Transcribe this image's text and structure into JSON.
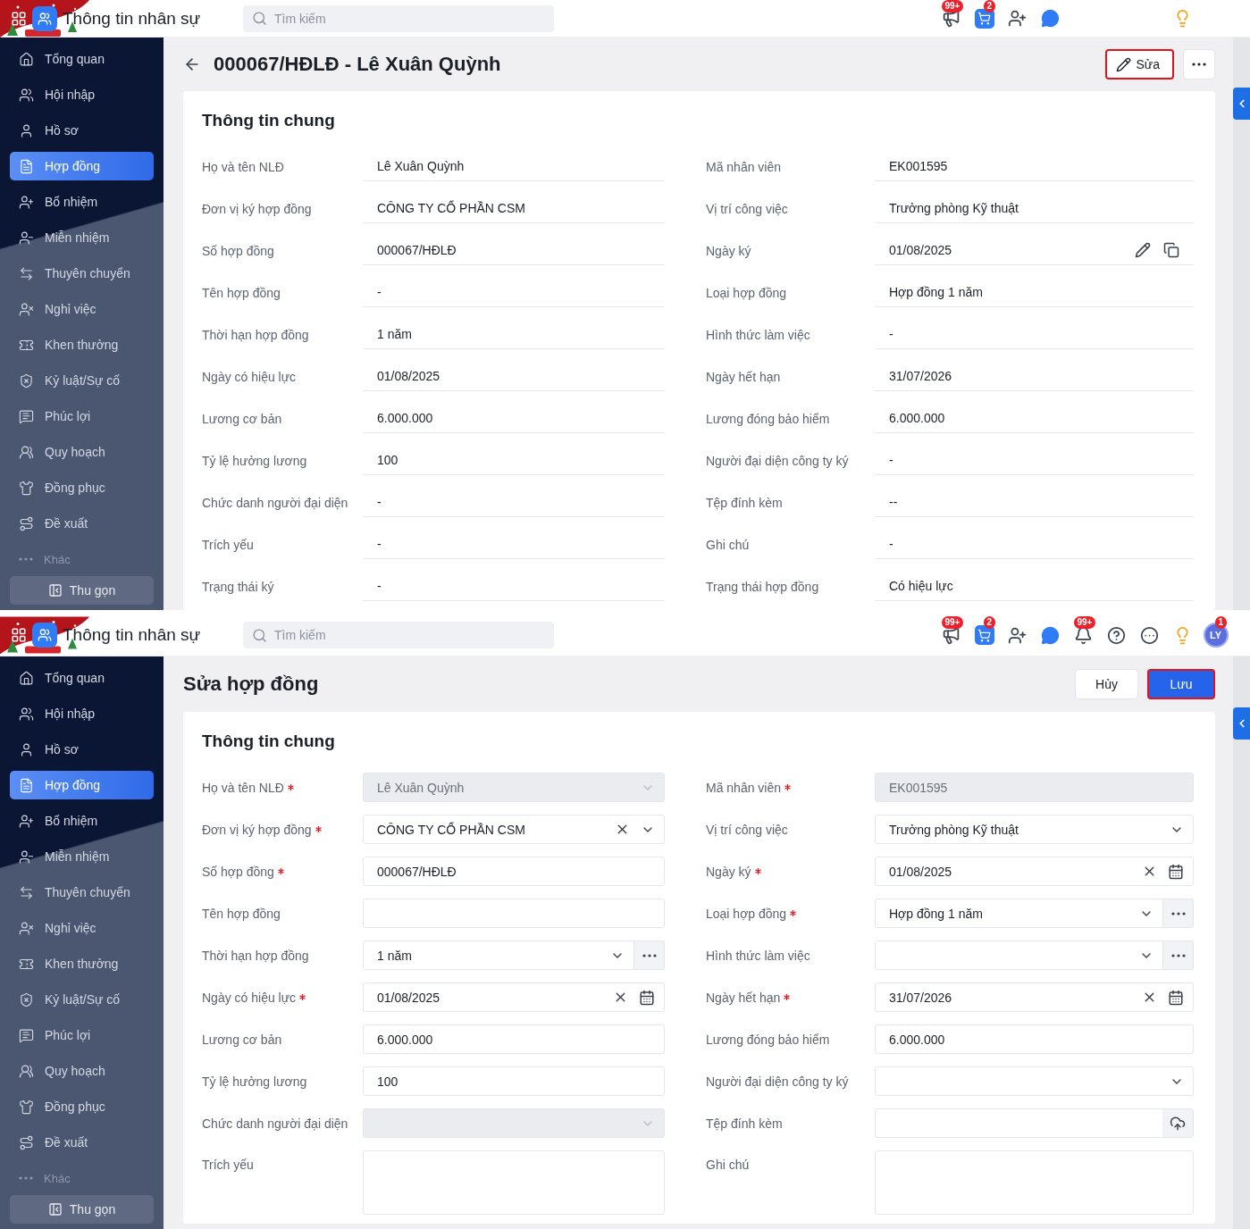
{
  "screens": [
    {
      "kind": "view",
      "header": {
        "app_title": "Thông tin nhân sự",
        "search": {
          "placeholder": "Tìm kiếm"
        },
        "icons": [
          {
            "kind": "megaphone",
            "badge": "99+"
          },
          {
            "kind": "cart",
            "badge": "2"
          },
          {
            "kind": "user-add"
          },
          {
            "kind": "chat"
          },
          {
            "kind": "lightbulb"
          }
        ]
      },
      "sidebar": {
        "items": [
          {
            "label": "Tổng quan",
            "selected": false
          },
          {
            "label": "Hội nhập",
            "selected": false
          },
          {
            "label": "Hồ sơ",
            "selected": false
          },
          {
            "label": "Hợp đồng",
            "selected": true
          },
          {
            "label": "Bổ nhiệm",
            "selected": false
          },
          {
            "label": "Miễn nhiệm",
            "selected": false
          },
          {
            "label": "Thuyên chuyển",
            "selected": false
          },
          {
            "label": "Nghỉ việc",
            "selected": false
          },
          {
            "label": "Khen thưởng",
            "selected": false
          },
          {
            "label": "Kỷ luật/Sự cố",
            "selected": false
          },
          {
            "label": "Phúc lợi",
            "selected": false
          },
          {
            "label": "Quy hoạch",
            "selected": false
          },
          {
            "label": "Đồng phục",
            "selected": false
          },
          {
            "label": "Đề xuất",
            "selected": false
          }
        ],
        "more_label": "Khác",
        "collapse_label": "Thu gọn"
      },
      "page": {
        "title": "000067/HĐLĐ - Lê Xuân Quỳnh",
        "buttons": [
          {
            "kind": "edit",
            "label": "Sửa",
            "highlighted": true
          },
          {
            "kind": "more",
            "highlighted": false
          }
        ],
        "section_title": "Thông tin chung",
        "fields": [
          {
            "label": "Họ và tên NLĐ",
            "value": "Lê Xuân Quỳnh"
          },
          {
            "label": "Mã nhân viên",
            "value": "EK001595"
          },
          {
            "label": "Đơn vị ký hợp đồng",
            "value": "CÔNG TY CỔ PHẦN CSM"
          },
          {
            "label": "Vị trí công việc",
            "value": "Trưởng phòng Kỹ thuật"
          },
          {
            "label": "Số hợp đồng",
            "value": "000067/HĐLĐ"
          },
          {
            "label": "Ngày ký",
            "value": "01/08/2025",
            "actions": true
          },
          {
            "label": "Tên hợp đồng",
            "value": "-"
          },
          {
            "label": "Loại hợp đồng",
            "value": "Hợp đồng 1 năm"
          },
          {
            "label": "Thời hạn hợp đồng",
            "value": "1 năm"
          },
          {
            "label": "Hình thức làm việc",
            "value": "-"
          },
          {
            "label": "Ngày có hiệu lực",
            "value": "01/08/2025"
          },
          {
            "label": "Ngày hết hạn",
            "value": "31/07/2026"
          },
          {
            "label": "Lương cơ bản",
            "value": "6.000.000"
          },
          {
            "label": "Lương đóng bảo hiểm",
            "value": "6.000.000"
          },
          {
            "label": "Tỷ lệ hưởng lương",
            "value": "100"
          },
          {
            "label": "Người đại diện công ty ký",
            "value": "-"
          },
          {
            "label": "Chức danh người đại diện",
            "value": "-"
          },
          {
            "label": "Tệp đính kèm",
            "value": "--"
          },
          {
            "label": "Trích yếu",
            "value": "-"
          },
          {
            "label": "Ghi chú",
            "value": "-"
          },
          {
            "label": "Trạng thái ký",
            "value": "-"
          },
          {
            "label": "Trạng thái hợp đồng",
            "value": "Có hiệu lực"
          }
        ]
      }
    },
    {
      "kind": "edit",
      "header": {
        "app_title": "Thông tin nhân sự",
        "search": {
          "placeholder": "Tìm kiếm"
        },
        "icons": [
          {
            "kind": "megaphone",
            "badge": "99+"
          },
          {
            "kind": "cart",
            "badge": "2"
          },
          {
            "kind": "user-add"
          },
          {
            "kind": "chat"
          },
          {
            "kind": "bell",
            "badge": "99+"
          },
          {
            "kind": "help"
          },
          {
            "kind": "more"
          },
          {
            "kind": "lightbulb"
          },
          {
            "kind": "avatar",
            "initials": "LY",
            "badge": "1"
          }
        ]
      },
      "sidebar": {
        "items": [
          {
            "label": "Tổng quan",
            "selected": false
          },
          {
            "label": "Hội nhập",
            "selected": false
          },
          {
            "label": "Hồ sơ",
            "selected": false
          },
          {
            "label": "Hợp đồng",
            "selected": true
          },
          {
            "label": "Bổ nhiệm",
            "selected": false
          },
          {
            "label": "Miễn nhiệm",
            "selected": false
          },
          {
            "label": "Thuyên chuyển",
            "selected": false
          },
          {
            "label": "Nghỉ việc",
            "selected": false
          },
          {
            "label": "Khen thưởng",
            "selected": false
          },
          {
            "label": "Kỷ luật/Sự cố",
            "selected": false
          },
          {
            "label": "Phúc lợi",
            "selected": false
          },
          {
            "label": "Quy hoạch",
            "selected": false
          },
          {
            "label": "Đồng phục",
            "selected": false
          },
          {
            "label": "Đề xuất",
            "selected": false
          }
        ],
        "more_label": "Khác",
        "collapse_label": "Thu gọn"
      },
      "page": {
        "title": "Sửa hợp đồng",
        "buttons": [
          {
            "kind": "cancel",
            "label": "Hủy",
            "highlighted": false
          },
          {
            "kind": "save",
            "label": "Lưu",
            "highlighted": true
          }
        ],
        "section_title": "Thông tin chung",
        "fields": [
          {
            "label": "Họ và tên NLĐ",
            "required": true,
            "kind": "select",
            "value": "Lê Xuân Quỳnh",
            "disabled": true
          },
          {
            "label": "Mã nhân viên",
            "required": true,
            "kind": "input",
            "value": "EK001595",
            "disabled": true
          },
          {
            "label": "Đơn vị ký hợp đồng",
            "required": true,
            "kind": "select",
            "value": "CÔNG TY CỔ PHẦN CSM",
            "clearable": true
          },
          {
            "label": "Vị trí công việc",
            "required": false,
            "kind": "select",
            "value": "Trưởng phòng Kỹ thuật"
          },
          {
            "label": "Số hợp đồng",
            "required": true,
            "kind": "input",
            "value": "000067/HĐLĐ"
          },
          {
            "label": "Ngày ký",
            "required": true,
            "kind": "date",
            "value": "01/08/2025",
            "clearable": true
          },
          {
            "label": "Tên hợp đồng",
            "required": false,
            "kind": "input"
          },
          {
            "label": "Loại hợp đồng",
            "required": true,
            "kind": "select",
            "value": "Hợp đồng 1 năm",
            "menu": true
          },
          {
            "label": "Thời hạn hợp đồng",
            "required": false,
            "kind": "select",
            "value": "1 năm",
            "menu": true
          },
          {
            "label": "Hình thức làm việc",
            "required": false,
            "kind": "select",
            "menu": true
          },
          {
            "label": "Ngày có hiệu lực",
            "required": true,
            "kind": "date",
            "value": "01/08/2025",
            "clearable": true
          },
          {
            "label": "Ngày hết hạn",
            "required": true,
            "kind": "date",
            "value": "31/07/2026",
            "clearable": true
          },
          {
            "label": "Lương cơ bản",
            "required": false,
            "kind": "input",
            "value": "6.000.000"
          },
          {
            "label": "Lương đóng bảo hiểm",
            "required": false,
            "kind": "input",
            "value": "6.000.000"
          },
          {
            "label": "Tỷ lệ hưởng lương",
            "required": false,
            "kind": "input",
            "value": "100"
          },
          {
            "label": "Người đại diện công ty ký",
            "required": false,
            "kind": "select"
          },
          {
            "label": "Chức danh người đại diện",
            "required": false,
            "kind": "select",
            "disabled": true
          },
          {
            "label": "Tệp đính kèm",
            "required": false,
            "kind": "file"
          },
          {
            "label": "Trích yếu",
            "required": false,
            "kind": "textarea"
          },
          {
            "label": "Ghi chú",
            "required": false,
            "kind": "textarea"
          }
        ]
      }
    }
  ]
}
